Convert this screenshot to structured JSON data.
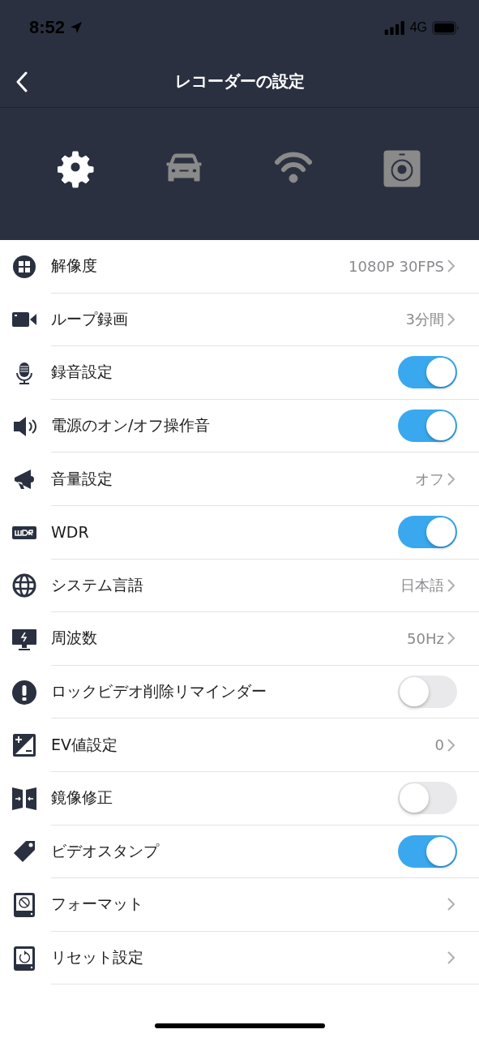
{
  "status_bar": {
    "time": "8:52",
    "network": "4G"
  },
  "nav": {
    "title": "レコーダーの設定"
  },
  "tabs": [
    {
      "selected": true
    },
    {
      "selected": false
    },
    {
      "selected": false
    },
    {
      "selected": false
    }
  ],
  "settings": [
    {
      "label": "解像度",
      "kind": "value",
      "value": "1080P 30FPS"
    },
    {
      "label": "ループ録画",
      "kind": "value",
      "value": "3分間"
    },
    {
      "label": "録音設定",
      "kind": "toggle",
      "on": true
    },
    {
      "label": "電源のオン/オフ操作音",
      "kind": "toggle",
      "on": true
    },
    {
      "label": "音量設定",
      "kind": "value",
      "value": "オフ"
    },
    {
      "label": "WDR",
      "kind": "toggle",
      "on": true
    },
    {
      "label": "システム言語",
      "kind": "value",
      "value": "日本語"
    },
    {
      "label": "周波数",
      "kind": "value",
      "value": "50Hz"
    },
    {
      "label": "ロックビデオ削除リマインダー",
      "kind": "toggle",
      "on": false
    },
    {
      "label": "EV値設定",
      "kind": "value",
      "value": "0"
    },
    {
      "label": "鏡像修正",
      "kind": "toggle",
      "on": false
    },
    {
      "label": "ビデオスタンプ",
      "kind": "toggle",
      "on": true
    },
    {
      "label": "フォーマット",
      "kind": "link"
    },
    {
      "label": "リセット設定",
      "kind": "link"
    }
  ]
}
